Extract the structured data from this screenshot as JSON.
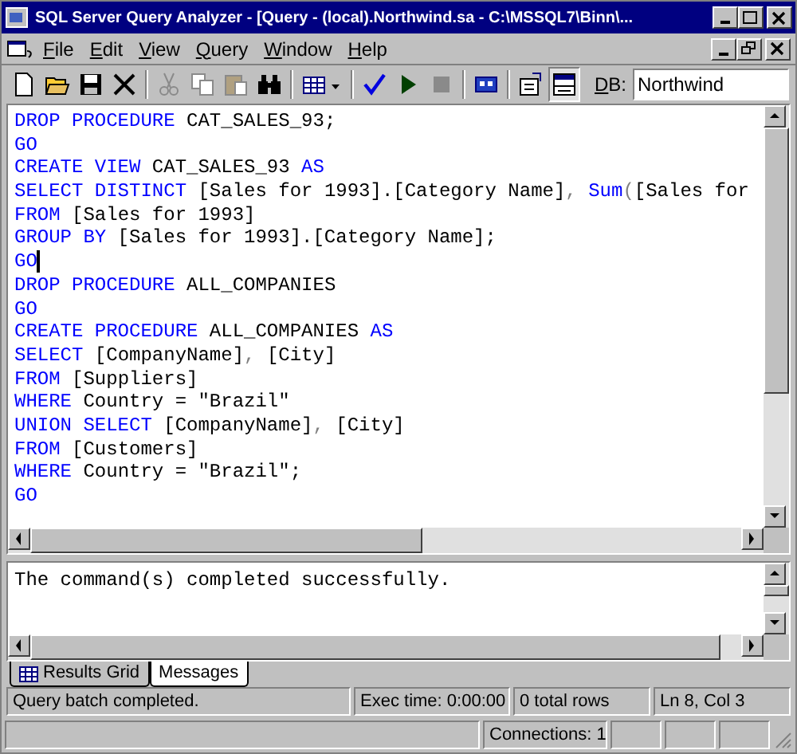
{
  "window": {
    "title": "SQL Server Query Analyzer - [Query - (local).Northwind.sa - C:\\MSSQL7\\Binn\\..."
  },
  "menu": [
    "File",
    "Edit",
    "View",
    "Query",
    "Window",
    "Help"
  ],
  "toolbar": [
    {
      "kind": "new",
      "disabled": false
    },
    {
      "kind": "open",
      "disabled": false
    },
    {
      "kind": "save",
      "disabled": false
    },
    {
      "kind": "delete",
      "disabled": false
    },
    {
      "kind": "separator"
    },
    {
      "kind": "cut",
      "disabled": true
    },
    {
      "kind": "copy",
      "disabled": true
    },
    {
      "kind": "paste",
      "disabled": true
    },
    {
      "kind": "find",
      "disabled": false
    },
    {
      "kind": "separator"
    },
    {
      "kind": "grid",
      "disabled": false
    },
    {
      "kind": "separator"
    },
    {
      "kind": "check",
      "disabled": false
    },
    {
      "kind": "run",
      "disabled": false
    },
    {
      "kind": "stop",
      "disabled": true
    },
    {
      "kind": "separator"
    },
    {
      "kind": "plan",
      "disabled": false
    },
    {
      "kind": "separator"
    },
    {
      "kind": "props",
      "disabled": false
    },
    {
      "kind": "panes",
      "disabled": false,
      "pressed": true
    }
  ],
  "database": {
    "label": "DB:",
    "value": "Northwind"
  },
  "editor": {
    "lines": [
      {
        "cursor": false,
        "tokens": [
          {
            "t": "DROP PROCEDURE",
            "kind": "keyword"
          },
          {
            "t": " CAT_SALES_93;",
            "kind": "plain"
          }
        ]
      },
      {
        "cursor": false,
        "tokens": [
          {
            "t": "GO",
            "kind": "keyword"
          }
        ]
      },
      {
        "cursor": false,
        "tokens": [
          {
            "t": "CREATE VIEW",
            "kind": "keyword"
          },
          {
            "t": " CAT_SALES_93 ",
            "kind": "plain"
          },
          {
            "t": "AS",
            "kind": "keyword"
          }
        ]
      },
      {
        "cursor": false,
        "tokens": [
          {
            "t": "SELECT DISTINCT",
            "kind": "keyword"
          },
          {
            "t": " [Sales for 1993].[Category Name]",
            "kind": "plain"
          },
          {
            "t": ", ",
            "kind": "operator"
          },
          {
            "t": "Sum",
            "kind": "keyword"
          },
          {
            "t": "(",
            "kind": "operator"
          },
          {
            "t": "[Sales for",
            "kind": "plain"
          }
        ]
      },
      {
        "cursor": false,
        "tokens": [
          {
            "t": "FROM",
            "kind": "keyword"
          },
          {
            "t": " [Sales for 1993]",
            "kind": "plain"
          }
        ]
      },
      {
        "cursor": false,
        "tokens": [
          {
            "t": "GROUP BY",
            "kind": "keyword"
          },
          {
            "t": " [Sales for 1993].[Category Name];",
            "kind": "plain"
          }
        ]
      },
      {
        "cursor": true,
        "tokens": [
          {
            "t": "GO",
            "kind": "keyword"
          }
        ]
      },
      {
        "cursor": false,
        "tokens": [
          {
            "t": "DROP PROCEDURE",
            "kind": "keyword"
          },
          {
            "t": " ALL_COMPANIES",
            "kind": "plain"
          }
        ]
      },
      {
        "cursor": false,
        "tokens": [
          {
            "t": "GO",
            "kind": "keyword"
          }
        ]
      },
      {
        "cursor": false,
        "tokens": [
          {
            "t": "CREATE PROCEDURE",
            "kind": "keyword"
          },
          {
            "t": " ALL_COMPANIES ",
            "kind": "plain"
          },
          {
            "t": "AS",
            "kind": "keyword"
          }
        ]
      },
      {
        "cursor": false,
        "tokens": [
          {
            "t": "SELECT",
            "kind": "keyword"
          },
          {
            "t": " [CompanyName]",
            "kind": "plain"
          },
          {
            "t": ", ",
            "kind": "operator"
          },
          {
            "t": "[City]",
            "kind": "plain"
          }
        ]
      },
      {
        "cursor": false,
        "tokens": [
          {
            "t": "FROM",
            "kind": "keyword"
          },
          {
            "t": " [Suppliers]",
            "kind": "plain"
          }
        ]
      },
      {
        "cursor": false,
        "tokens": [
          {
            "t": "WHERE",
            "kind": "keyword"
          },
          {
            "t": " Country = \"Brazil\"",
            "kind": "plain"
          }
        ]
      },
      {
        "cursor": false,
        "tokens": [
          {
            "t": "UNION SELECT",
            "kind": "keyword"
          },
          {
            "t": " [CompanyName]",
            "kind": "plain"
          },
          {
            "t": ", ",
            "kind": "operator"
          },
          {
            "t": "[City]",
            "kind": "plain"
          }
        ]
      },
      {
        "cursor": false,
        "tokens": [
          {
            "t": "FROM",
            "kind": "keyword"
          },
          {
            "t": " [Customers]",
            "kind": "plain"
          }
        ]
      },
      {
        "cursor": false,
        "tokens": [
          {
            "t": "WHERE",
            "kind": "keyword"
          },
          {
            "t": " Country = \"Brazil\";",
            "kind": "plain"
          }
        ]
      },
      {
        "cursor": false,
        "tokens": [
          {
            "t": "GO",
            "kind": "keyword"
          }
        ]
      }
    ]
  },
  "results": {
    "message": "The command(s) completed successfully."
  },
  "tabs": [
    {
      "label": "Results Grid",
      "selected": false,
      "kind": "grid"
    },
    {
      "label": "Messages",
      "selected": true,
      "kind": "text"
    }
  ],
  "status_bar": [
    "Query batch completed.",
    "Exec time: 0:00:00",
    "0 total rows",
    "Ln 8, Col 3"
  ],
  "app_status": {
    "connections": "Connections: 1"
  }
}
